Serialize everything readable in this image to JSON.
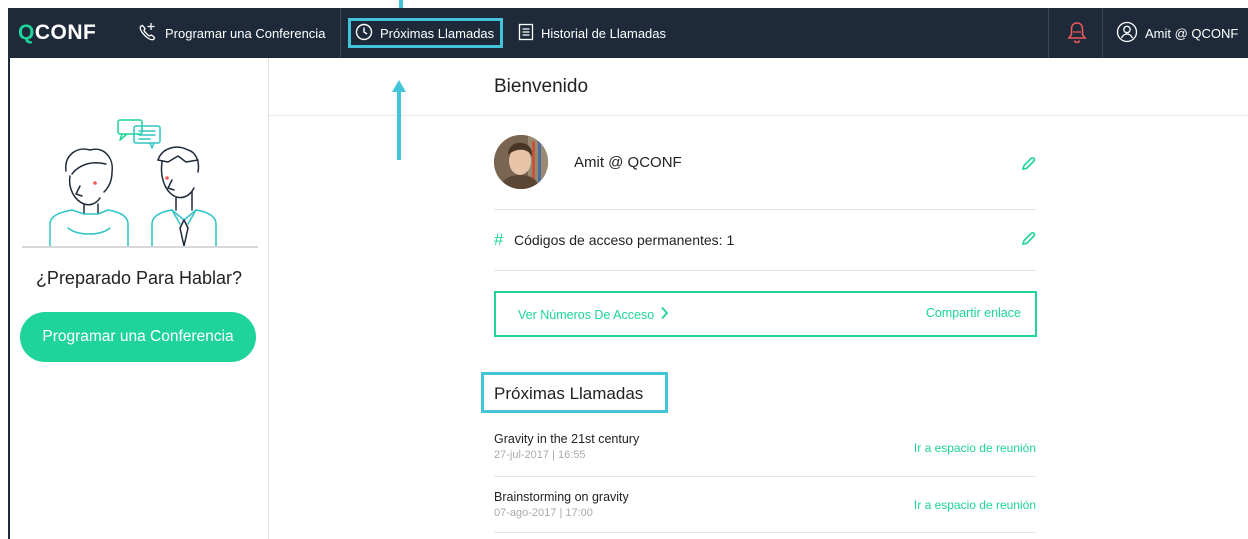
{
  "nav": {
    "logo_q": "Q",
    "logo_rest": "CONF",
    "schedule_label": "Programar una Conferencia",
    "upcoming_label": "Próximas Llamadas",
    "history_label": "Historial de Llamadas",
    "user_label": "Amit @ QCONF"
  },
  "sidebar": {
    "ready_text": "¿Preparado Para Hablar?",
    "schedule_button": "Programar una Conferencia"
  },
  "main": {
    "welcome": "Bienvenido",
    "profile_name": "Amit @ QCONF",
    "codes_symbol": "#",
    "codes_text": "Códigos de acceso permanentes: 1",
    "access_numbers_link": "Ver Números De Acceso",
    "share_link": "Compartir enlace",
    "upcoming_title": "Próximas Llamadas",
    "calls": [
      {
        "title": "Gravity in the 21st century",
        "date": "27-jul-2017 | 16:55",
        "link": "Ir a espacio de reunión"
      },
      {
        "title": "Brainstorming on gravity",
        "date": "07-ago-2017 | 17:00",
        "link": "Ir a espacio de reunión"
      }
    ]
  },
  "colors": {
    "navbar": "#1e2a3a",
    "accent_green": "#1ed49a",
    "highlight_cyan": "#43c4d9",
    "bell_red": "#ef5a5a"
  },
  "icons": [
    "phone-plus-icon",
    "clock-icon",
    "document-list-icon",
    "bell-icon",
    "user-circle-icon",
    "pencil-icon",
    "chevron-right-icon"
  ]
}
